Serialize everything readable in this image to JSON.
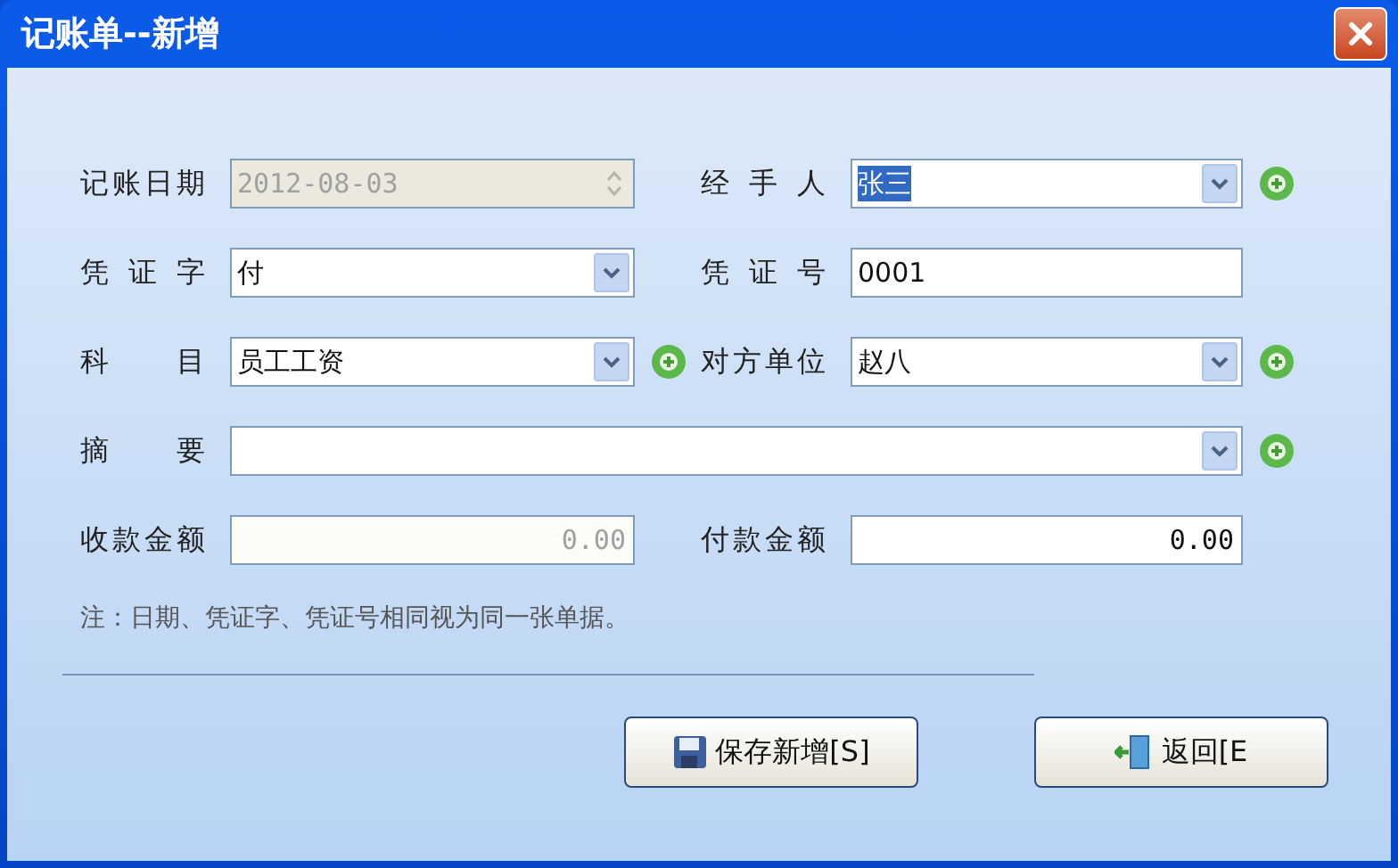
{
  "window": {
    "title": "记账单--新增"
  },
  "rows": [
    {
      "fields": [
        {
          "label": "记账日期",
          "kind": "spinner",
          "value": "2012-08-03",
          "disabled": true,
          "add_button": false
        },
        {
          "label": "经 手 人",
          "kind": "dropdown",
          "value": "张三",
          "text_selected": true,
          "add_button": true
        }
      ]
    },
    {
      "fields": [
        {
          "label": "凭 证 字",
          "kind": "dropdown",
          "value": "付",
          "add_button": false
        },
        {
          "label": "凭 证 号",
          "kind": "text",
          "value": "0001",
          "add_button": false
        }
      ]
    },
    {
      "fields": [
        {
          "label": "科 目",
          "kind": "dropdown",
          "value": "员工工资",
          "add_button": true
        },
        {
          "label": "对方单位",
          "kind": "dropdown",
          "value": "赵八",
          "add_button": true
        }
      ]
    },
    {
      "fields": [
        {
          "label": "摘 要",
          "kind": "dropdown",
          "wide": true,
          "add_button": true
        }
      ]
    },
    {
      "fields": [
        {
          "label": "收款金额",
          "kind": "number",
          "value": "0.00",
          "disabled": true,
          "add_button": false
        },
        {
          "label": "付款金额",
          "kind": "number",
          "value": "0.00",
          "add_button": false
        }
      ]
    }
  ],
  "note": "注：日期、凭证字、凭证号相同视为同一张单据。",
  "buttons": [
    {
      "kind": "save",
      "label": "保存新增[S]"
    },
    {
      "kind": "back",
      "label": "返回[E"
    }
  ]
}
